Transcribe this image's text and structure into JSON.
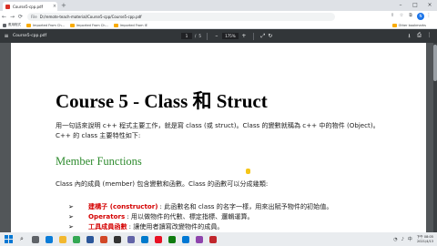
{
  "browser": {
    "tab": {
      "title": "Course5-cpp.pdf",
      "close": "×"
    },
    "new_tab": "+",
    "window_controls": {
      "minimize": "–",
      "maximize": "□",
      "close": "×"
    },
    "nav": {
      "back": "←",
      "forward": "→",
      "reload": "⟳"
    },
    "address": {
      "scheme_label": "File",
      "url": "D:/remote-teach-material/Course5-cpp/Course5-cpp.pdf"
    },
    "toolbar_icons": {
      "share": "⇪",
      "star": "☆",
      "extensions": "⧉",
      "profile": "N",
      "menu": "⋮"
    },
    "bookmarks": [
      {
        "label": "應用程式",
        "icon": "apps-icon"
      },
      {
        "label": "Imported From Ch...",
        "icon": "folder-icon"
      },
      {
        "label": "Imported From Ch...",
        "icon": "folder-icon"
      },
      {
        "label": "Imported From IE",
        "icon": "folder-icon"
      }
    ],
    "other_bookmarks": "Other bookmarks"
  },
  "pdf_viewer": {
    "menu_icon": "≡",
    "file_name": "Course5-cpp.pdf",
    "current_page": "1",
    "page_separator": "/",
    "total_pages": "5",
    "zoom_out": "–",
    "zoom_level": "175%",
    "zoom_in": "+",
    "fit_icon": "⤢",
    "rotate_icon": "↻",
    "download_icon": "⭳",
    "print_icon": "⎙",
    "more_icon": "⋮"
  },
  "document": {
    "title": "Course 5 - Class 和 Struct",
    "intro": "用一句話來說明 c++ 程式主要工作，就是寫 class (或 struct)。Class 的變數就稱為 c++ 中的物件 (Object)。C++ 的 class 主要特性如下:",
    "section_heading": "Member Functions",
    "section_intro": "Class 內的成員 (member) 包含變數和函數。Class 的函數可以分成幾類:",
    "bullet_mark": "➢",
    "bullets": [
      {
        "term": "建構子 (constructor)",
        "desc": ": 此函數名和 class 的名字一樣，用來出賦予物件的初始值。"
      },
      {
        "term": "Operators",
        "desc": ": 用以做物件的代數、標定指標、邏輯運算。"
      },
      {
        "term": "工具成員函數",
        "desc": ": 讓使用者讀寫改變物件的成員。"
      }
    ]
  },
  "taskbar": {
    "search_icon": "⌕",
    "apps": [
      {
        "name": "task-view-icon",
        "color": "#5f6368"
      },
      {
        "name": "edge-icon",
        "color": "#0a7cd8"
      },
      {
        "name": "file-explorer-icon",
        "color": "#f2b82f"
      },
      {
        "name": "chrome-icon",
        "color": "#34a853"
      },
      {
        "name": "word-icon",
        "color": "#2b579a"
      },
      {
        "name": "powerpoint-icon",
        "color": "#d24726"
      },
      {
        "name": "terminal-icon",
        "color": "#333333"
      },
      {
        "name": "teams-icon",
        "color": "#6264a7"
      },
      {
        "name": "vscode-icon",
        "color": "#007acc"
      },
      {
        "name": "paint-icon",
        "color": "#e81123"
      },
      {
        "name": "app-icon",
        "color": "#107c10"
      },
      {
        "name": "mail-icon",
        "color": "#0078d4"
      },
      {
        "name": "photos-icon",
        "color": "#8e44ad"
      },
      {
        "name": "pdf-icon",
        "color": "#c1272d"
      }
    ],
    "tray": {
      "wifi": "◔",
      "volume": "♪",
      "ime": "中"
    },
    "clock": {
      "time": "下午 08:05",
      "date": "2021/4/13"
    }
  },
  "colors": {
    "pdf_toolbar": "#323639",
    "viewer_bg": "#525659",
    "section_green": "#2e8b2e",
    "term_red": "#d40000"
  }
}
